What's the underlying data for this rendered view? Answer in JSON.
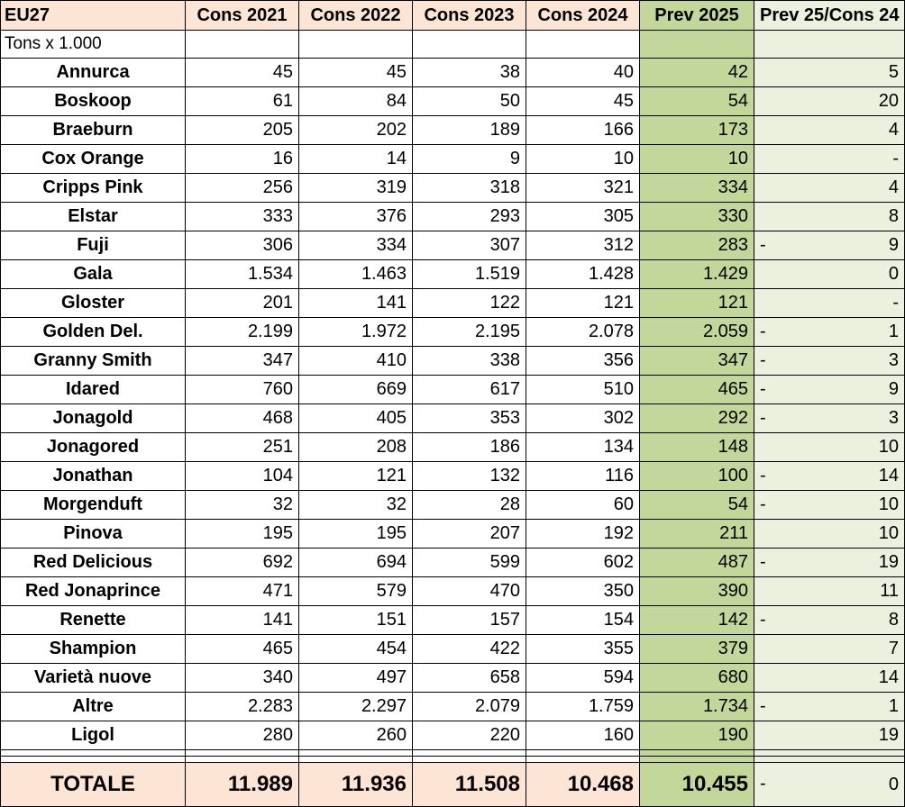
{
  "table": {
    "region": "EU27",
    "unit_label": "Tons x 1.000",
    "headers": [
      "Cons 2021",
      "Cons 2022",
      "Cons 2023",
      "Cons 2024",
      "Prev 2025",
      "Prev 25/Cons 24"
    ],
    "rows": [
      {
        "name": "Annurca",
        "values": [
          "45",
          "45",
          "38",
          "40",
          "42"
        ],
        "neg": "",
        "delta": "5"
      },
      {
        "name": "Boskoop",
        "values": [
          "61",
          "84",
          "50",
          "45",
          "54"
        ],
        "neg": "",
        "delta": "20"
      },
      {
        "name": "Braeburn",
        "values": [
          "205",
          "202",
          "189",
          "166",
          "173"
        ],
        "neg": "",
        "delta": "4"
      },
      {
        "name": "Cox Orange",
        "values": [
          "16",
          "14",
          "9",
          "10",
          "10"
        ],
        "neg": "",
        "delta": "-"
      },
      {
        "name": "Cripps Pink",
        "values": [
          "256",
          "319",
          "318",
          "321",
          "334"
        ],
        "neg": "",
        "delta": "4"
      },
      {
        "name": "Elstar",
        "values": [
          "333",
          "376",
          "293",
          "305",
          "330"
        ],
        "neg": "",
        "delta": "8"
      },
      {
        "name": "Fuji",
        "values": [
          "306",
          "334",
          "307",
          "312",
          "283"
        ],
        "neg": "-",
        "delta": "9"
      },
      {
        "name": "Gala",
        "values": [
          "1.534",
          "1.463",
          "1.519",
          "1.428",
          "1.429"
        ],
        "neg": "",
        "delta": "0"
      },
      {
        "name": "Gloster",
        "values": [
          "201",
          "141",
          "122",
          "121",
          "121"
        ],
        "neg": "",
        "delta": "-"
      },
      {
        "name": "Golden Del.",
        "values": [
          "2.199",
          "1.972",
          "2.195",
          "2.078",
          "2.059"
        ],
        "neg": "-",
        "delta": "1"
      },
      {
        "name": "Granny Smith",
        "values": [
          "347",
          "410",
          "338",
          "356",
          "347"
        ],
        "neg": "-",
        "delta": "3"
      },
      {
        "name": "Idared",
        "values": [
          "760",
          "669",
          "617",
          "510",
          "465"
        ],
        "neg": "-",
        "delta": "9"
      },
      {
        "name": "Jonagold",
        "values": [
          "468",
          "405",
          "353",
          "302",
          "292"
        ],
        "neg": "-",
        "delta": "3"
      },
      {
        "name": "Jonagored",
        "values": [
          "251",
          "208",
          "186",
          "134",
          "148"
        ],
        "neg": "",
        "delta": "10"
      },
      {
        "name": "Jonathan",
        "values": [
          "104",
          "121",
          "132",
          "116",
          "100"
        ],
        "neg": "-",
        "delta": "14"
      },
      {
        "name": "Morgenduft",
        "values": [
          "32",
          "32",
          "28",
          "60",
          "54"
        ],
        "neg": "-",
        "delta": "10"
      },
      {
        "name": "Pinova",
        "values": [
          "195",
          "195",
          "207",
          "192",
          "211"
        ],
        "neg": "",
        "delta": "10"
      },
      {
        "name": "Red Delicious",
        "values": [
          "692",
          "694",
          "599",
          "602",
          "487"
        ],
        "neg": "-",
        "delta": "19"
      },
      {
        "name": "Red Jonaprince",
        "values": [
          "471",
          "579",
          "470",
          "350",
          "390"
        ],
        "neg": "",
        "delta": "11"
      },
      {
        "name": "Renette",
        "values": [
          "141",
          "151",
          "157",
          "154",
          "142"
        ],
        "neg": "-",
        "delta": "8"
      },
      {
        "name": "Shampion",
        "values": [
          "465",
          "454",
          "422",
          "355",
          "379"
        ],
        "neg": "",
        "delta": "7"
      },
      {
        "name": "Varietà nuove",
        "values": [
          "340",
          "497",
          "658",
          "594",
          "680"
        ],
        "neg": "",
        "delta": "14"
      },
      {
        "name": "Altre",
        "values": [
          "2.283",
          "2.297",
          "2.079",
          "1.759",
          "1.734"
        ],
        "neg": "-",
        "delta": "1"
      },
      {
        "name": "Ligol",
        "values": [
          "280",
          "260",
          "220",
          "160",
          "190"
        ],
        "neg": "",
        "delta": "19"
      }
    ],
    "total": {
      "name": "TOTALE",
      "values": [
        "11.989",
        "11.936",
        "11.508",
        "10.468",
        "10.455"
      ],
      "neg": "-",
      "delta": "0"
    }
  },
  "colors": {
    "header_bg": "#fde5d6",
    "forecast_bg": "#c4d79b",
    "delta_bg": "#ebf1de"
  }
}
